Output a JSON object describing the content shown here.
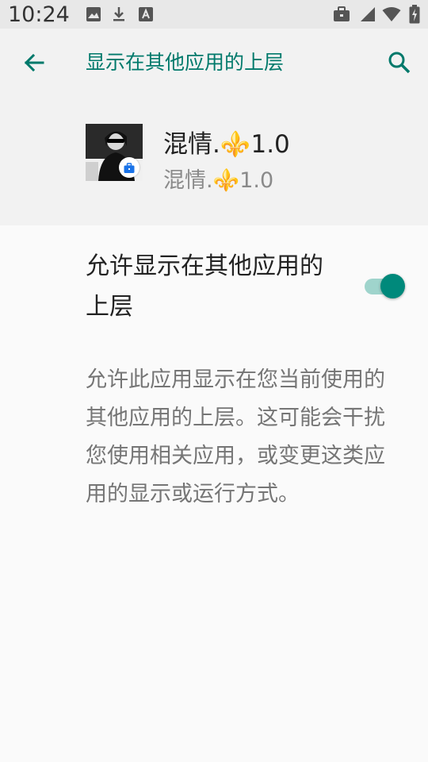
{
  "status_bar": {
    "time": "10:24",
    "left_icons": [
      "image-icon",
      "download-icon",
      "font-icon"
    ],
    "right_icons": [
      "briefcase-icon",
      "signal-icon",
      "wifi-icon",
      "battery-charging-icon"
    ]
  },
  "toolbar": {
    "back_icon": "arrow-back-icon",
    "title": "显示在其他应用的上层",
    "search_icon": "search-icon",
    "accent_color": "#00796b"
  },
  "app": {
    "name_prefix": "混情.",
    "name_suffix": "1.0",
    "subtitle_prefix": "混情.",
    "subtitle_suffix": "1.0",
    "emoji": "⚜️",
    "badge_icon": "work-briefcase-icon"
  },
  "permission": {
    "label": "允许显示在其他应用的上层",
    "enabled": true,
    "toggle_color": "#00897b"
  },
  "summary": "允许此应用显示在您当前使用的其他应用的上层。这可能会干扰您使用相关应用，或变更这类应用的显示或运行方式。"
}
